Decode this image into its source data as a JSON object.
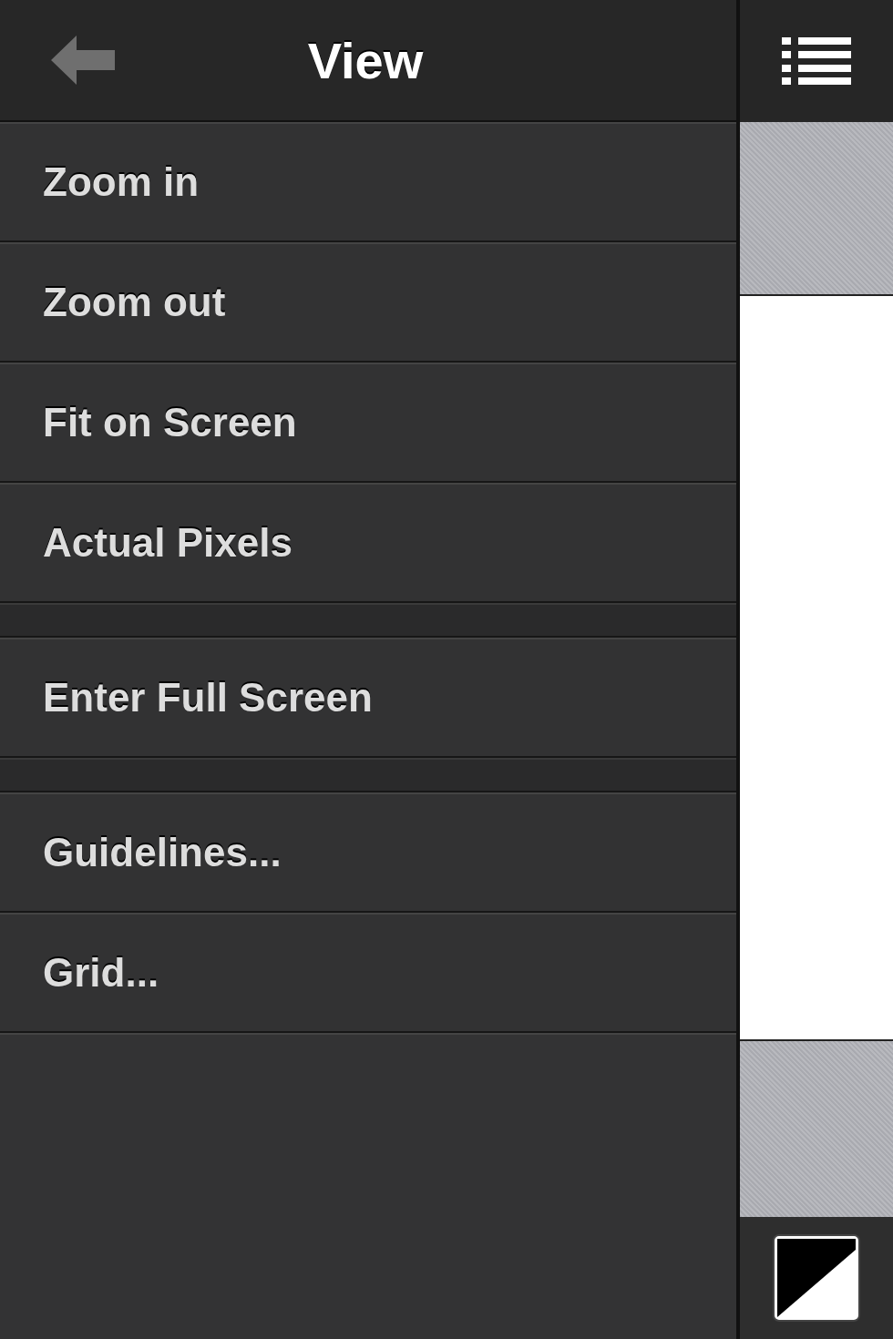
{
  "header": {
    "title": "View"
  },
  "menu_groups": [
    {
      "items": [
        {
          "label": "Zoom in"
        },
        {
          "label": "Zoom out"
        },
        {
          "label": "Fit on Screen"
        },
        {
          "label": "Actual Pixels"
        }
      ]
    },
    {
      "items": [
        {
          "label": "Enter Full Screen"
        }
      ]
    },
    {
      "items": [
        {
          "label": "Guidelines..."
        },
        {
          "label": "Grid..."
        }
      ]
    }
  ]
}
